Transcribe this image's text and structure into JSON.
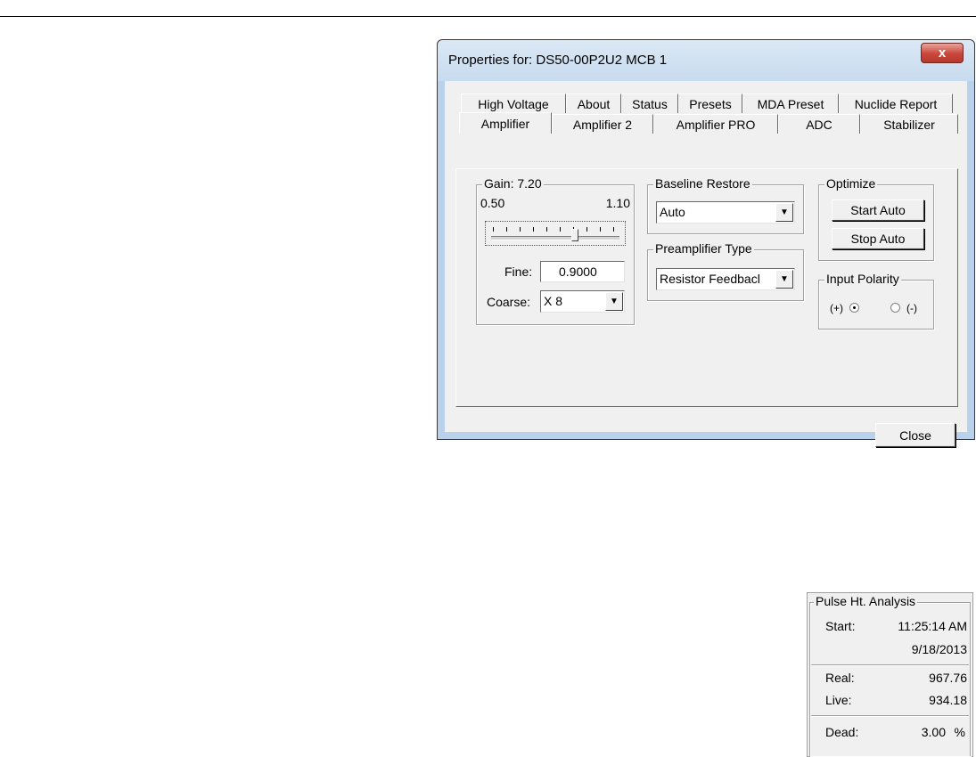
{
  "dialog": {
    "title": "Properties for: DS50-00P2U2 MCB 1",
    "close_glyph": "x",
    "tabs_row1": [
      "High Voltage",
      "About",
      "Status",
      "Presets",
      "MDA Preset",
      "Nuclide Report"
    ],
    "tabs_row2": [
      "Amplifier",
      "Amplifier 2",
      "Amplifier PRO",
      "ADC",
      "Stabilizer"
    ],
    "active_tab": "Amplifier",
    "gain": {
      "legend": "Gain: 7.20",
      "min_label": "0.50",
      "max_label": "1.10",
      "slider_fraction": 0.67,
      "fine_label": "Fine:",
      "fine_value": "0.9000",
      "coarse_label": "Coarse:",
      "coarse_value": "X 8"
    },
    "baseline": {
      "legend": "Baseline Restore",
      "value": "Auto"
    },
    "preamp": {
      "legend": "Preamplifier Type",
      "value": "Resistor Feedbacl"
    },
    "optimize": {
      "legend": "Optimize",
      "start_label": "Start Auto",
      "stop_label": "Stop Auto"
    },
    "polarity": {
      "legend": "Input Polarity",
      "plus_label": "(+)",
      "minus_label": "(-)",
      "selected": "(+)"
    },
    "close_label": "Close"
  },
  "pha": {
    "legend": "Pulse Ht. Analysis",
    "start_label": "Start:",
    "start_time": "11:25:14 AM",
    "start_date": "9/18/2013",
    "real_label": "Real:",
    "real_value": "967.76",
    "live_label": "Live:",
    "live_value": "934.18",
    "dead_label": "Dead:",
    "dead_value": "3.00",
    "dead_unit": "%"
  },
  "colors": {
    "titlebar": "#c7dbef",
    "close_button": "#c9463a",
    "face": "#f0f0f0"
  },
  "icons": {
    "close": "close-icon",
    "dropdown": "chevron-down-icon"
  }
}
